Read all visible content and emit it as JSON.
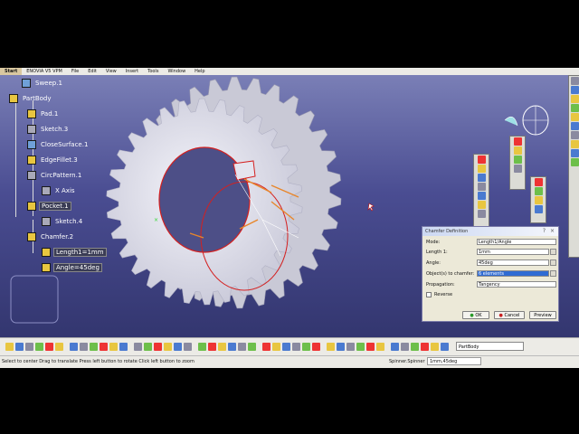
{
  "menubar": {
    "items": [
      "Start",
      "ENOVIA V5 VPM",
      "File",
      "Edit",
      "View",
      "Insert",
      "Tools",
      "Window",
      "Help"
    ]
  },
  "tree": {
    "items": [
      {
        "label": "Sweep.1",
        "icon": "sweep-icon"
      },
      {
        "label": "PartBody",
        "icon": "gear-icon"
      },
      {
        "label": "Pad.1",
        "icon": "pad-icon"
      },
      {
        "label": "Sketch.3",
        "icon": "sketch-icon"
      },
      {
        "label": "CloseSurface.1",
        "icon": "close-surface-icon"
      },
      {
        "label": "EdgeFillet.3",
        "icon": "edge-fillet-icon"
      },
      {
        "label": "CircPattern.1",
        "icon": "circular-pattern-icon"
      },
      {
        "label": "X Axis",
        "icon": "axis-icon"
      },
      {
        "label": "Pocket.1",
        "icon": "pocket-icon"
      },
      {
        "label": "Sketch.4",
        "icon": "sketch-icon"
      },
      {
        "label": "Chamfer.2",
        "icon": "chamfer-icon"
      },
      {
        "label": "Length1=1mm",
        "icon": "parameter-icon"
      },
      {
        "label": "Angle=45deg",
        "icon": "parameter-icon"
      }
    ]
  },
  "dialog": {
    "title": "Chamfer Definition",
    "mode_label": "Mode:",
    "mode_value": "Length1/Angle",
    "length_label": "Length 1:",
    "length_value": "1mm",
    "angle_label": "Angle:",
    "angle_value": "45deg",
    "objects_label": "Object(s) to chamfer:",
    "objects_value": "6 elements",
    "propagation_label": "Propagation:",
    "propagation_value": "Tangency",
    "reverse_label": "Reverse",
    "reverse_checked": false,
    "ok": "OK",
    "cancel": "Cancel",
    "preview": "Preview"
  },
  "bottom": {
    "body_select": "PartBody"
  },
  "status": {
    "hint": "Select to center  Drag to translate  Press left button to rotate  Click left button to zoom",
    "command_label": "Spinner.Spinner",
    "command_value": "1mm,45deg"
  },
  "colors": {
    "background_top": "#7a7fb6",
    "background_bottom": "#33366f",
    "gear": "#e4e4ee",
    "selection_edge": "#d42020",
    "dialog_selected": "#2f6bd3"
  }
}
